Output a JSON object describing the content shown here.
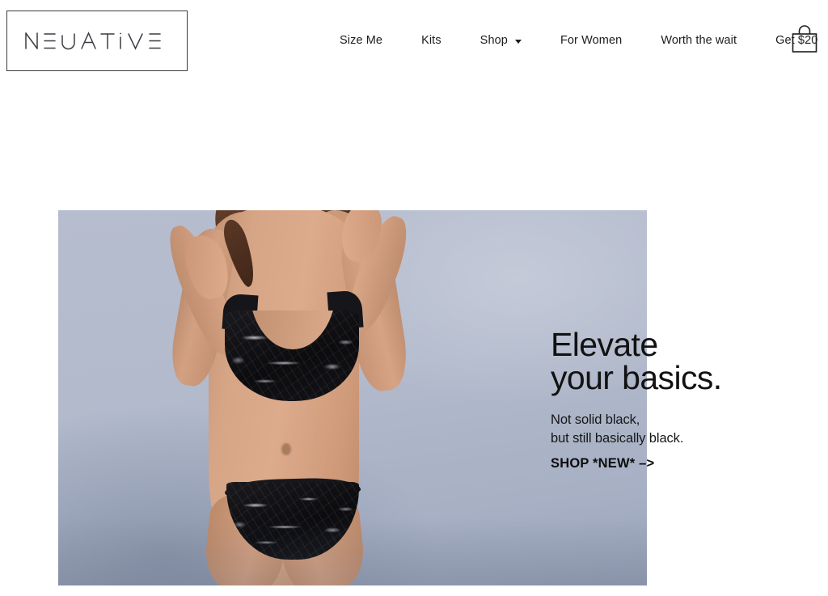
{
  "brand": {
    "logo_text": "NEGATIVE",
    "logo_aria": "negative-logo"
  },
  "nav": {
    "items": [
      {
        "label": "Size Me",
        "has_dropdown": false
      },
      {
        "label": "Kits",
        "has_dropdown": false
      },
      {
        "label": "Shop",
        "has_dropdown": true
      },
      {
        "label": "For Women",
        "has_dropdown": false
      },
      {
        "label": "Worth the wait",
        "has_dropdown": false
      },
      {
        "label": "Get $20",
        "has_dropdown": false
      }
    ],
    "cart_label": "cart-icon"
  },
  "hero": {
    "headline_line1": "Elevate",
    "headline_line2": "your basics.",
    "sub_line1": "Not solid black,",
    "sub_line2": "but still basically black.",
    "cta_label": "SHOP *NEW* –>",
    "image_alt": "model-wearing-black-marble-bralette-and-briefs",
    "background_color": "#b3bbcd"
  },
  "colors": {
    "page_background": "#ffffff",
    "text": "#1a1a1a",
    "hero_backdrop": "#b3bbcd",
    "garment": "#111114"
  }
}
